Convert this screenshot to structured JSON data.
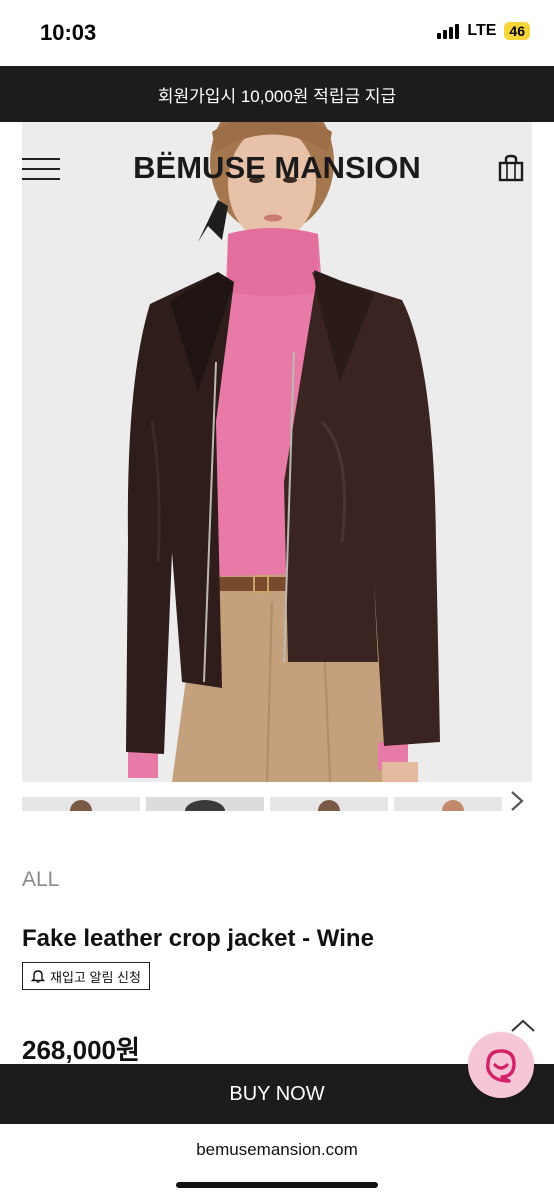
{
  "status": {
    "time": "10:03",
    "network": "LTE",
    "battery": "46"
  },
  "promo": {
    "text": "회원가입시 10,000원 적립금 지급"
  },
  "brand": {
    "logo": "BËMUSE MANSION"
  },
  "product": {
    "category": "ALL",
    "name": "Fake leather crop jacket - Wine",
    "restock_label": "재입고 알림 신청",
    "price": "268,000원",
    "thumbnail_count": 4
  },
  "actions": {
    "buy_now": "BUY NOW"
  },
  "browser": {
    "url": "bemusemansion.com"
  },
  "colors": {
    "bar_bg": "#1c1c1c",
    "chat_bg": "#f7c6d6",
    "chat_icon": "#d2236a",
    "battery": "#f5d53a"
  },
  "icons": {
    "menu": "hamburger-icon",
    "cart": "shopping-bag-icon",
    "next": "chevron-right-icon",
    "top": "chevron-up-icon",
    "chat": "chat-icon",
    "bell": "bell-icon"
  }
}
